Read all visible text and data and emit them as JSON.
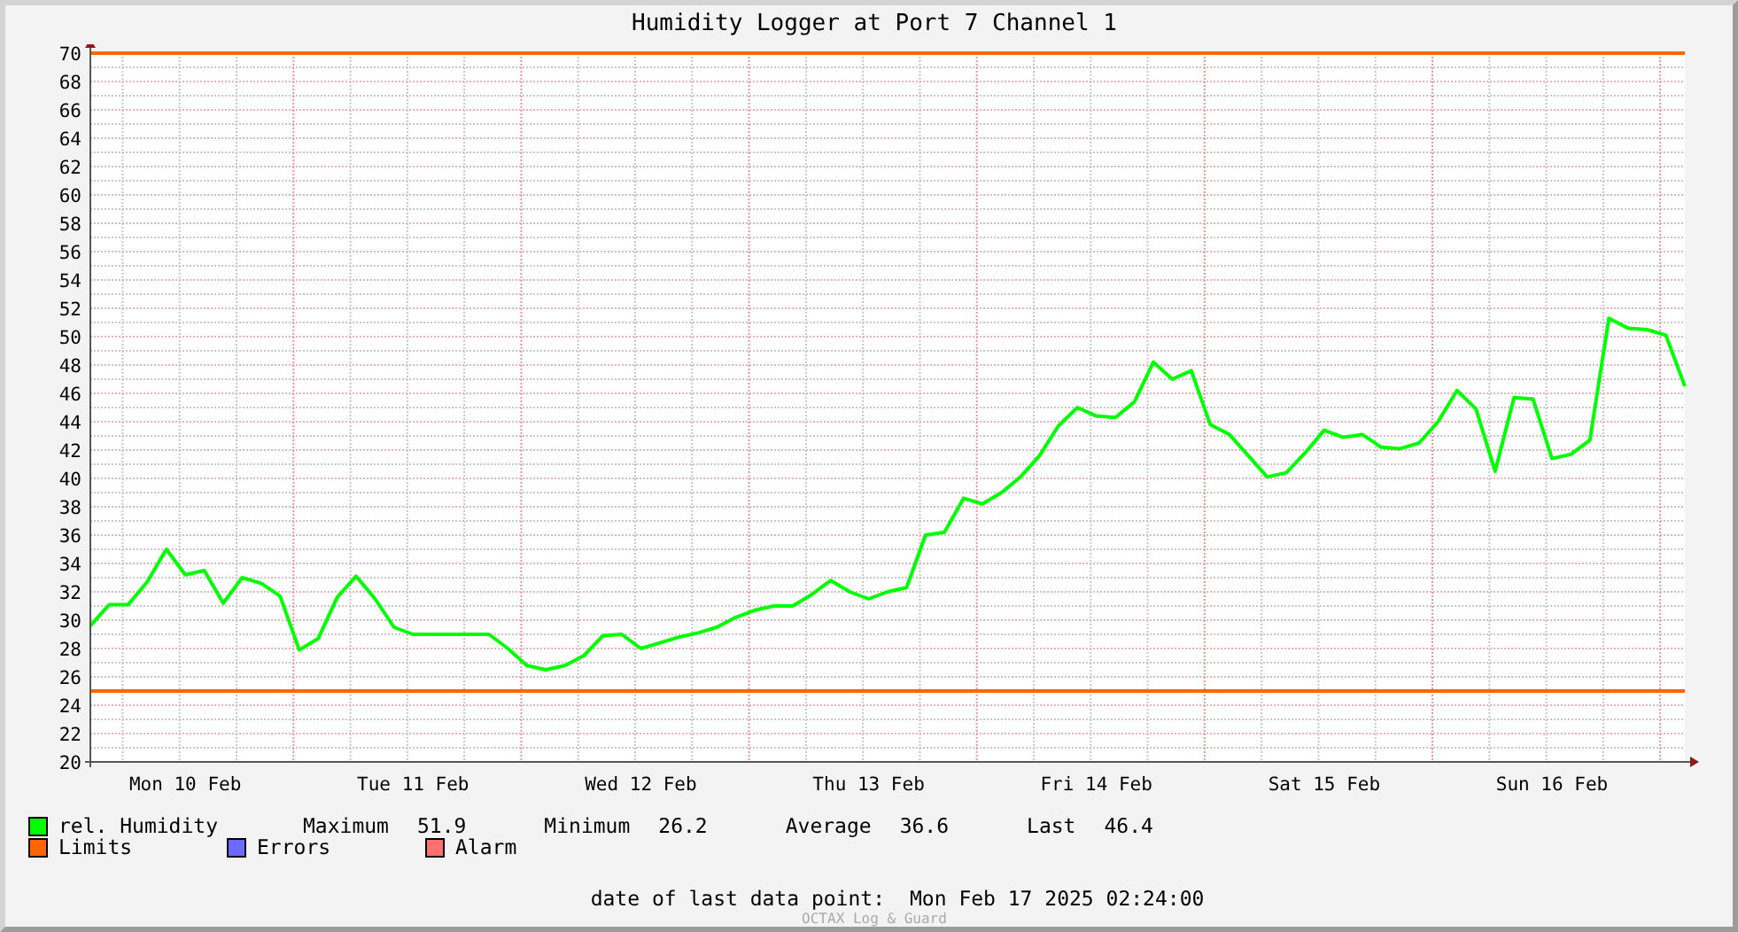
{
  "graph": {
    "title": "Humidity Logger at Port 7 Channel 1",
    "chart_data": {
      "type": "line",
      "ylim": [
        20,
        70
      ],
      "yticks": [
        20,
        22,
        24,
        26,
        28,
        30,
        32,
        34,
        36,
        38,
        40,
        42,
        44,
        46,
        48,
        50,
        52,
        54,
        56,
        58,
        60,
        62,
        64,
        66,
        68,
        70
      ],
      "categories": [
        null,
        null,
        null,
        null,
        null,
        "Mon 10 Feb",
        null,
        null,
        null,
        null,
        null,
        null,
        null,
        null,
        null,
        null,
        null,
        "Tue 11 Feb",
        null,
        null,
        null,
        null,
        null,
        null,
        null,
        null,
        null,
        null,
        null,
        "Wed 12 Feb",
        null,
        null,
        null,
        null,
        null,
        null,
        null,
        null,
        null,
        null,
        null,
        "Thu 13 Feb",
        null,
        null,
        null,
        null,
        null,
        null,
        null,
        null,
        null,
        null,
        null,
        "Fri 14 Feb",
        null,
        null,
        null,
        null,
        null,
        null,
        null,
        null,
        null,
        null,
        null,
        "Sat 15 Feb",
        null,
        null,
        null,
        null,
        null,
        null,
        null,
        null,
        null,
        null,
        null,
        "Sun 16 Feb",
        null,
        null,
        null,
        null,
        null,
        null,
        null
      ],
      "series": [
        {
          "name": "rel. Humidity",
          "color": "#00ff00",
          "values": [
            29.6,
            31.1,
            31.1,
            32.7,
            35,
            33.2,
            33.5,
            31.2,
            33,
            32.6,
            31.7,
            27.9,
            28.7,
            31.6,
            33.1,
            31.5,
            29.5,
            29,
            29,
            29,
            29,
            29,
            28,
            26.8,
            26.5,
            26.8,
            27.5,
            28.9,
            29,
            28,
            28.4,
            28.8,
            29.1,
            29.5,
            30.2,
            30.7,
            31,
            31,
            31.8,
            32.8,
            32,
            31.5,
            32,
            32.3,
            36,
            36.2,
            38.6,
            38.2,
            39,
            40.1,
            41.6,
            43.7,
            45,
            44.4,
            44.3,
            45.4,
            48.2,
            47,
            47.6,
            43.8,
            43.1,
            41.6,
            40.1,
            40.4,
            41.8,
            43.4,
            42.9,
            43.1,
            42.2,
            42.1,
            42.5,
            44,
            46.2,
            44.9,
            40.5,
            45.7,
            45.6,
            41.4,
            41.7,
            42.7,
            51.3,
            50.6,
            50.5,
            50.1,
            46.5
          ]
        }
      ],
      "grid": true,
      "ref_lines": [
        {
          "axis": "y",
          "value": 70
        },
        {
          "axis": "y",
          "value": 25
        }
      ]
    }
  },
  "legend": [
    {
      "label": "Limits",
      "color": "#ff6600"
    },
    {
      "label": "Errors",
      "color": "#6b6bff"
    },
    {
      "label": "Alarm",
      "color": "#ff7070"
    }
  ],
  "stats": [
    {
      "label": "Maximum",
      "value": "51.9"
    },
    {
      "label": "Minimum",
      "value": "26.2"
    },
    {
      "label": "Average",
      "value": "36.6"
    },
    {
      "label": "Last",
      "value": "46.4"
    }
  ],
  "last_data_point": {
    "label": "date of last data point:",
    "value": "Mon Feb 17 2025 02:24:00"
  },
  "credit": "OCTAX Log & Guard"
}
